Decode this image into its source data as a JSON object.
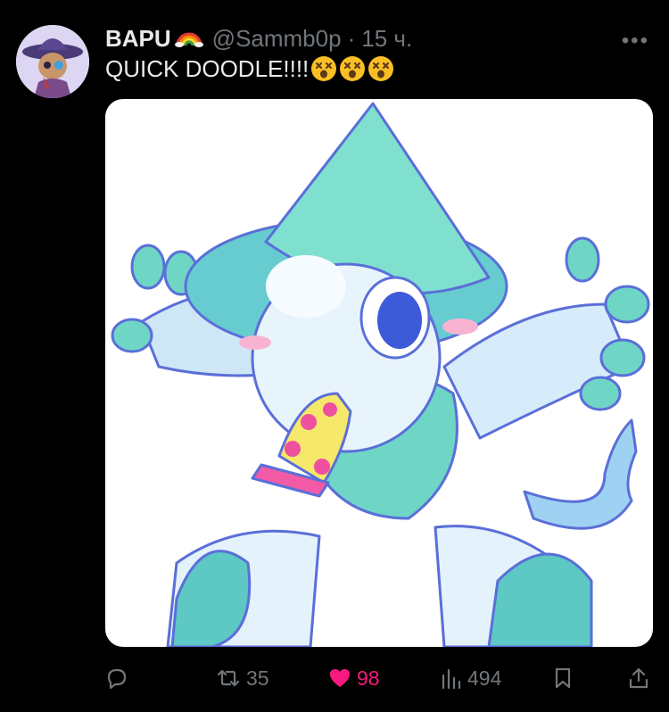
{
  "tweet": {
    "author_name": "BAPU",
    "handle": "@Sammb0p",
    "separator": "·",
    "time": "15 ч.",
    "text": "QUICK DOODLE!!!!",
    "text_emojis": [
      "dizzy-face",
      "dizzy-face",
      "dizzy-face"
    ],
    "more_label": "•••"
  },
  "actions": {
    "reply": {
      "icon": "reply-icon"
    },
    "retweet": {
      "icon": "retweet-icon",
      "count": "35"
    },
    "like": {
      "icon": "heart-icon",
      "count": "98",
      "liked": true
    },
    "views": {
      "icon": "views-icon",
      "count": "494"
    },
    "bookmark": {
      "icon": "bookmark-icon"
    },
    "share": {
      "icon": "share-icon"
    }
  },
  "colors": {
    "background": "#000000",
    "text": "#e7e9ea",
    "muted": "#71767b",
    "like": "#f91880"
  }
}
